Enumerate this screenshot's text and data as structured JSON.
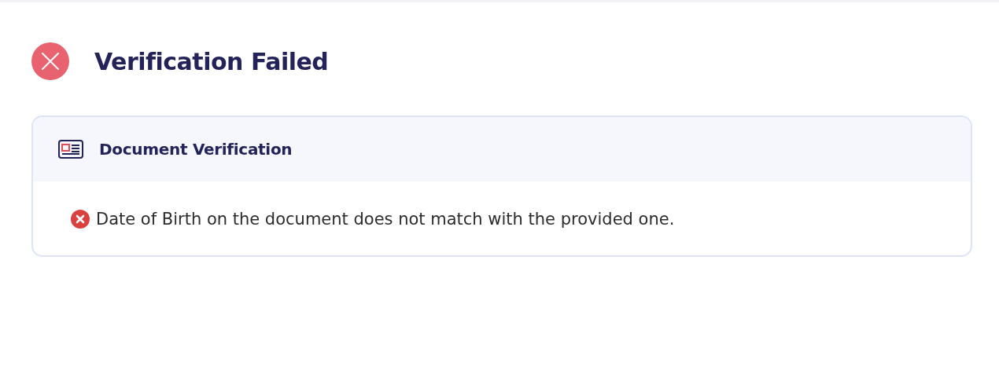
{
  "title": "Verification Failed",
  "card": {
    "title": "Document Verification",
    "issues": [
      {
        "text": "Date of Birth on the document does not match with the provided one."
      }
    ]
  }
}
